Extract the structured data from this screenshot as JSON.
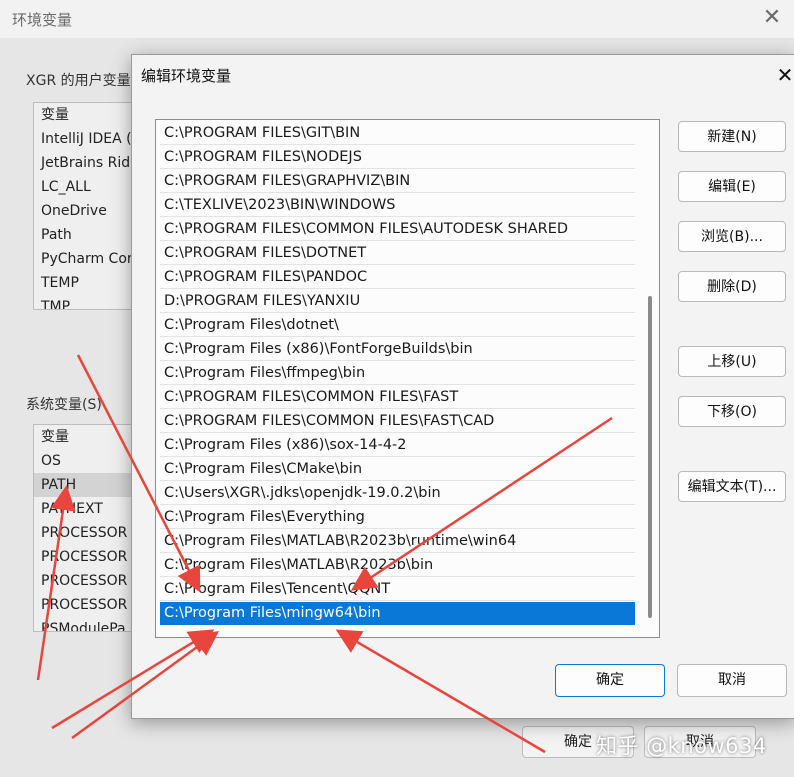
{
  "background_window": {
    "title": "环境变量",
    "user_vars_label": "XGR 的用户变量",
    "user_vars": [
      "变量",
      "IntelliJ IDEA (",
      "JetBrains Rid",
      "LC_ALL",
      "OneDrive",
      "Path",
      "PyCharm Cor",
      "TEMP",
      "TMP"
    ],
    "system_vars_label": "系统变量(S)",
    "system_vars": [
      "变量",
      "OS",
      "PATH",
      "PATHEXT",
      "PROCESSOR",
      "PROCESSOR",
      "PROCESSOR",
      "PROCESSOR",
      "PSModulePa"
    ],
    "selected_system_var": "PATH",
    "ok_label": "确定",
    "cancel_label": "取消"
  },
  "dialog": {
    "title": "编辑环境变量",
    "paths": [
      "C:\\PROGRAM FILES\\GIT\\BIN",
      "C:\\PROGRAM FILES\\NODEJS",
      "C:\\PROGRAM FILES\\GRAPHVIZ\\BIN",
      "C:\\TEXLIVE\\2023\\BIN\\WINDOWS",
      "C:\\PROGRAM FILES\\COMMON FILES\\AUTODESK SHARED",
      "C:\\PROGRAM FILES\\DOTNET",
      "C:\\PROGRAM FILES\\PANDOC",
      "D:\\PROGRAM FILES\\YANXIU",
      "C:\\Program Files\\dotnet\\",
      "C:\\Program Files (x86)\\FontForgeBuilds\\bin",
      "C:\\Program Files\\ffmpeg\\bin",
      "C:\\PROGRAM FILES\\COMMON FILES\\FAST",
      "C:\\PROGRAM FILES\\COMMON FILES\\FAST\\CAD",
      "C:\\Program Files (x86)\\sox-14-4-2",
      "C:\\Program Files\\CMake\\bin",
      "C:\\Users\\XGR\\.jdks\\openjdk-19.0.2\\bin",
      "C:\\Program Files\\Everything",
      "C:\\Program Files\\MATLAB\\R2023b\\runtime\\win64",
      "C:\\Program Files\\MATLAB\\R2023b\\bin",
      "C:\\Program Files\\Tencent\\QQNT",
      "C:\\Program Files\\mingw64\\bin"
    ],
    "selected_index": 20,
    "buttons": {
      "new": "新建(N)",
      "edit": "编辑(E)",
      "browse": "浏览(B)...",
      "delete": "删除(D)",
      "move_up": "上移(U)",
      "move_down": "下移(O)",
      "edit_text": "编辑文本(T)..."
    },
    "ok_label": "确定",
    "cancel_label": "取消"
  },
  "watermark": "知乎 @know634",
  "annotation_color": "#e8453c"
}
